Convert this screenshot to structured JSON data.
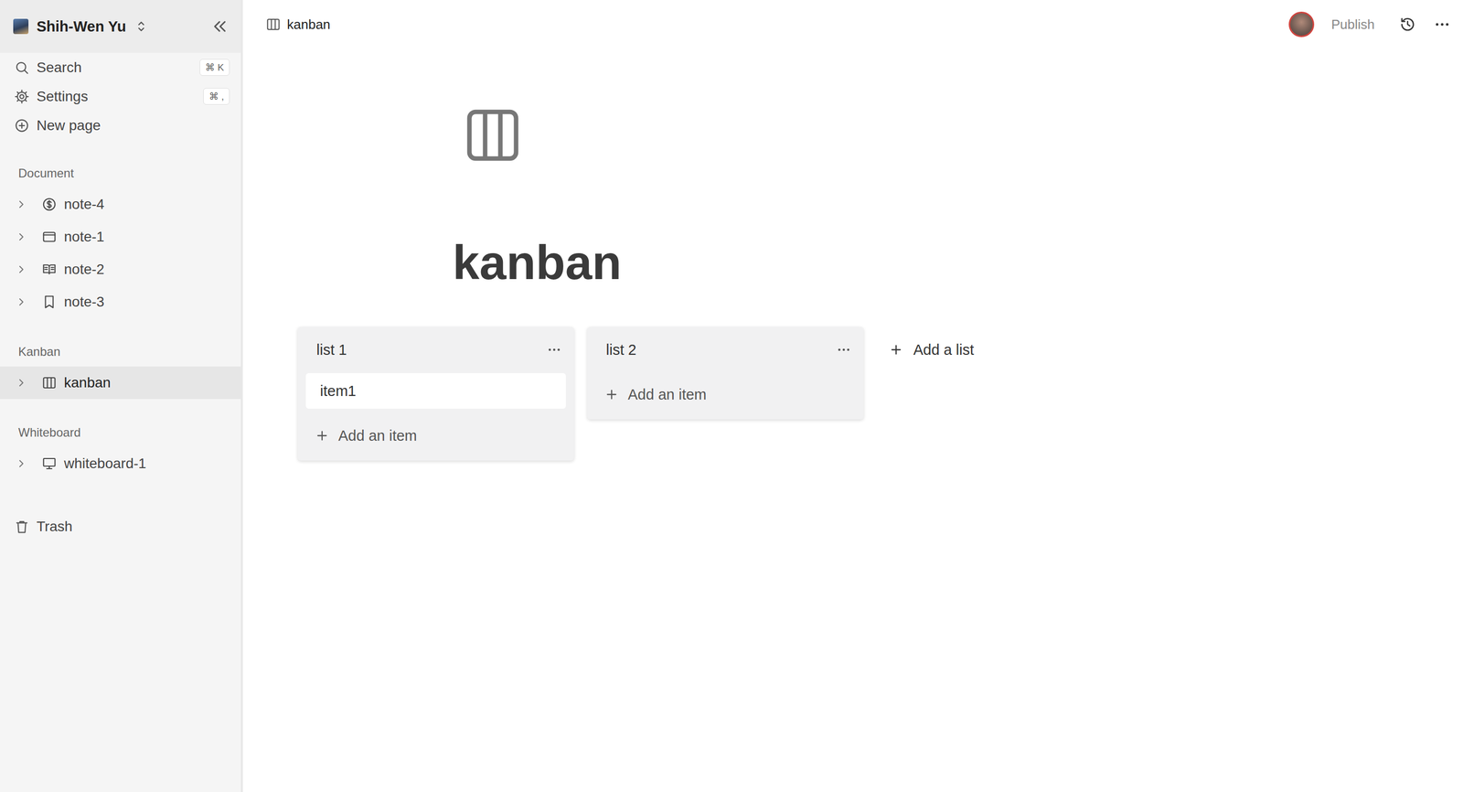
{
  "workspace": {
    "name": "Shih-Wen Yu"
  },
  "sidebar": {
    "actions": [
      {
        "label": "Search",
        "shortcut": "⌘ K"
      },
      {
        "label": "Settings",
        "shortcut": "⌘ ,"
      },
      {
        "label": "New page"
      }
    ],
    "sections": [
      {
        "title": "Document",
        "items": [
          {
            "label": "note-4",
            "selected": false,
            "expanded": false
          },
          {
            "label": "note-1",
            "selected": false,
            "expanded": false
          },
          {
            "label": "note-2",
            "selected": false,
            "expanded": false
          },
          {
            "label": "note-3",
            "selected": false,
            "expanded": false
          }
        ]
      },
      {
        "title": "Kanban",
        "items": [
          {
            "label": "kanban",
            "selected": true,
            "expanded": false
          }
        ]
      },
      {
        "title": "Whiteboard",
        "items": [
          {
            "label": "whiteboard-1",
            "selected": false,
            "expanded": false
          }
        ]
      }
    ],
    "trash": "Trash"
  },
  "topbar": {
    "breadcrumb": "kanban",
    "publish": "Publish"
  },
  "page": {
    "title": "kanban"
  },
  "board": {
    "lists": [
      {
        "title": "list 1",
        "items": [
          "item1"
        ],
        "add_label": "Add an item"
      },
      {
        "title": "list 2",
        "items": [],
        "add_label": "Add an item"
      }
    ],
    "add_list": "Add a list"
  }
}
